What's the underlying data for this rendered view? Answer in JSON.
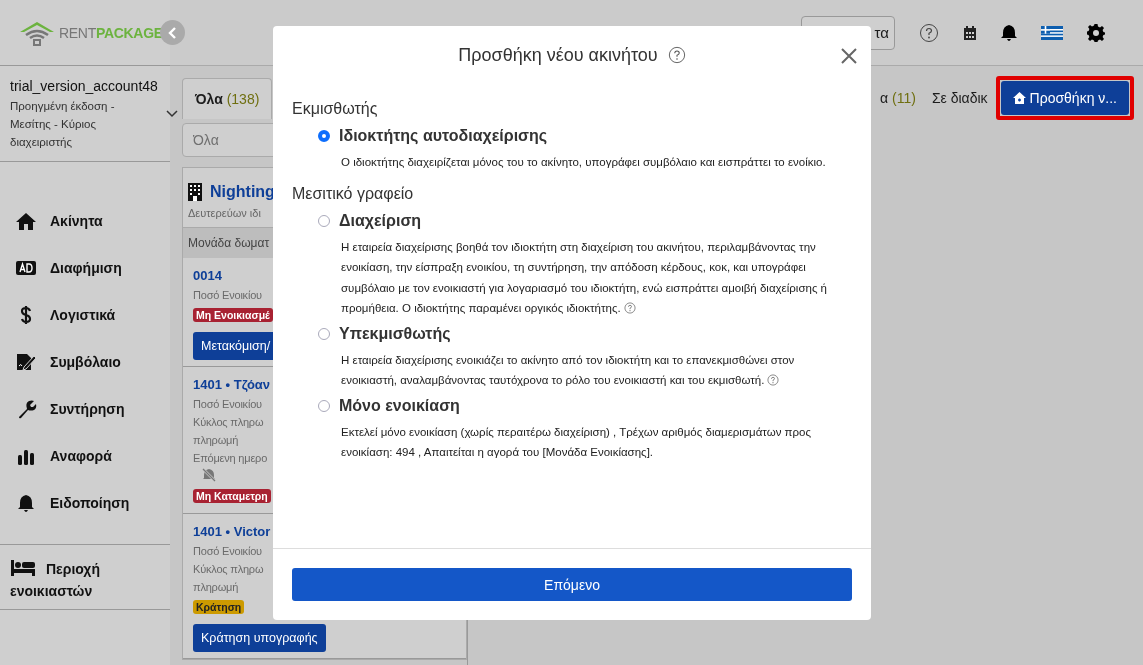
{
  "sidebar": {
    "logo": {
      "part_1": "RENT",
      "part_2": "PACKAGE"
    },
    "account": {
      "name": "trial_version_account48",
      "role": "Προηγμένη έκδοση - Μεσίτης - Κύριος διαχειριστής"
    },
    "nav": [
      {
        "label": "Ακίνητα"
      },
      {
        "label": "Διαφήμιση"
      },
      {
        "label": "Λογιστικά"
      },
      {
        "label": "Συμβόλαιο"
      },
      {
        "label": "Συντήρηση"
      },
      {
        "label": "Αναφορά"
      },
      {
        "label": "Ειδοποίηση"
      }
    ],
    "tenant_area": "Περιοχή ενοικιαστών"
  },
  "topbar": {
    "button_fragment": "τα"
  },
  "tabs": [
    {
      "label": "Όλα",
      "count": "(138)",
      "selected": true
    },
    {
      "label": "α",
      "count": "(11)",
      "selected": false
    },
    {
      "label": "Σε διαδικ",
      "selected": false
    }
  ],
  "add_button": "Προσθήκη ν...",
  "search": {
    "placeholder": "Όλα"
  },
  "building": {
    "name": "Nighting",
    "subtitle": "Δευτερεύων ιδι",
    "group_header": "Μονάδα δωματ"
  },
  "units": [
    {
      "title": "0014",
      "lines": [
        "Ποσό Ενοικίου"
      ],
      "muted_bell": false,
      "badge": {
        "text": "Μη Ενοικιασμέ",
        "color": "#a82232"
      },
      "action": "Μετακόμιση/"
    },
    {
      "title": "1401 • Τζόαν",
      "lines": [
        "Ποσό Ενοικίου",
        "Κύκλος πληρω",
        "πληρωμή",
        "Επόμενη ημερο"
      ],
      "muted_bell": true,
      "badge": {
        "text": "Μη Καταμετρη",
        "color": "#a82232"
      }
    },
    {
      "title": "1401 • Victor",
      "lines": [
        "Ποσό Ενοικίου",
        "Κύκλος πληρω",
        "πληρωμή"
      ],
      "muted_bell": false,
      "badge": {
        "text": "Κράτηση",
        "color": "#cc9a00"
      },
      "action": "Κράτηση υπογραφής"
    }
  ],
  "modal": {
    "title": "Προσθήκη νέου ακινήτου",
    "sections": [
      {
        "heading": "Εκμισθωτής",
        "options": [
          {
            "label": "Ιδιοκτήτης αυτοδιαχείρισης",
            "description": "Ο ιδιοκτήτης διαχειρίζεται μόνος του το ακίνητο, υπογράφει συμβόλαιο και εισπράττει το ενοίκιο.",
            "help": false,
            "selected": true
          }
        ]
      },
      {
        "heading": "Μεσιτικό γραφείο",
        "options": [
          {
            "label": "Διαχείριση",
            "description": "Η εταιρεία διαχείρισης βοηθά τον ιδιοκτήτη στη διαχείριση του ακινήτου, περιλαμβάνοντας την ενοικίαση, την είσπραξη ενοικίου, τη συντήρηση, την απόδοση κέρδους, κοκ, και υπογράφει συμβόλαιο με τον ενοικιαστή για λογαριασμό του ιδιοκτήτη, ενώ εισπράττει αμοιβή διαχείρισης ή προμήθεια. Ο ιδιοκτήτης παραμένει οργικός ιδιοκτήτης.",
            "help": true,
            "selected": false
          },
          {
            "label": "Υπεκμισθωτής",
            "description": "Η εταιρεία διαχείρισης ενοικιάζει το ακίνητο από τον ιδιοκτήτη και το επανεκμισθώνει στον ενοικιαστή, αναλαμβάνοντας ταυτόχρονα το ρόλο του ενοικιαστή και του εκμισθωτή.",
            "help": true,
            "selected": false
          },
          {
            "label": "Μόνο ενοικίαση",
            "description": "Εκτελεί μόνο ενοικίαση (χωρίς περαιτέρω διαχείριση) , Τρέχων αριθμός διαμερισμάτων προς ενοικίαση: 494 , Απαιτείται η αγορά του [Μονάδα Ενοικίασης].",
            "help": false,
            "selected": false
          }
        ]
      }
    ],
    "next_button": "Επόμενο"
  }
}
